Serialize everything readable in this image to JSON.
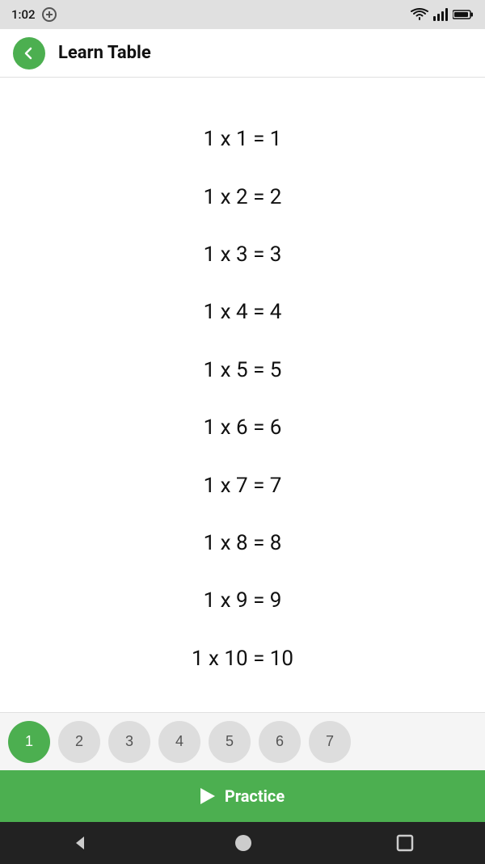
{
  "statusBar": {
    "time": "1:02",
    "icons": [
      "data-icon",
      "wifi",
      "signal",
      "battery"
    ]
  },
  "appBar": {
    "title": "Learn Table",
    "backButton": "back"
  },
  "equations": [
    "1  x  1  =  1",
    "1  x  2  =  2",
    "1  x  3  =  3",
    "1  x  4  =  4",
    "1  x  5  =  5",
    "1  x  6  =  6",
    "1  x  7  =  7",
    "1  x  8  =  8",
    "1  x  9  =  9",
    "1  x  10  =  10"
  ],
  "numberTabs": [
    1,
    2,
    3,
    4,
    5,
    6,
    7
  ],
  "activeTab": 1,
  "practiceButton": {
    "label": "Practice"
  }
}
